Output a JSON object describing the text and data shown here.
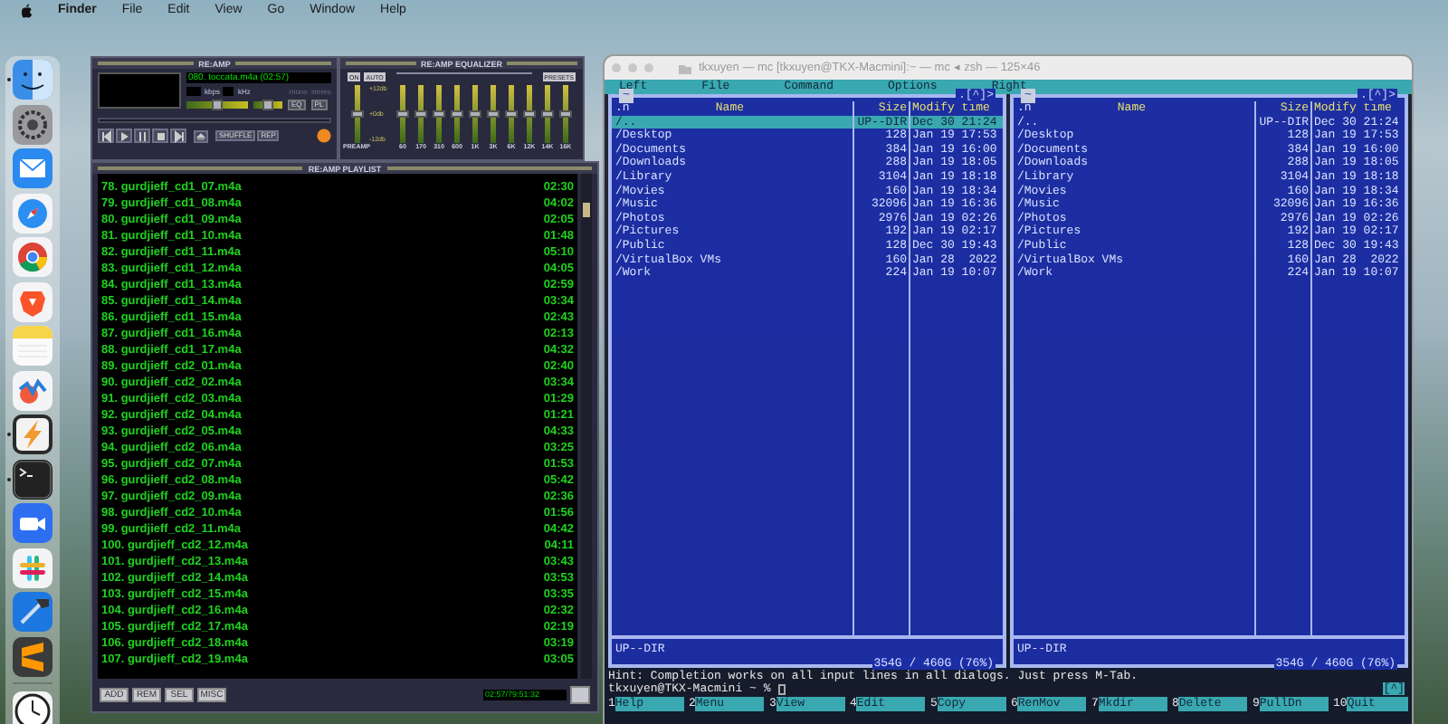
{
  "menu_bar": {
    "app": "Finder",
    "items": [
      "File",
      "Edit",
      "View",
      "Go",
      "Window",
      "Help"
    ]
  },
  "dock": {
    "items": [
      {
        "kind": "finder",
        "running": true
      },
      {
        "kind": "settings",
        "running": false
      },
      {
        "kind": "mail",
        "running": false
      },
      {
        "kind": "safari",
        "running": false
      },
      {
        "kind": "chrome",
        "running": false
      },
      {
        "kind": "brave",
        "running": false
      },
      {
        "kind": "notes",
        "running": false
      },
      {
        "kind": "freeform",
        "running": false
      },
      {
        "kind": "bolt",
        "running": true
      },
      {
        "kind": "terminal",
        "running": true
      },
      {
        "kind": "zoom",
        "running": false
      },
      {
        "kind": "slack",
        "running": false
      },
      {
        "kind": "xcode",
        "running": false
      },
      {
        "kind": "sublime",
        "running": false
      },
      {
        "kind": "clock",
        "running": false
      }
    ]
  },
  "player": {
    "title": "RE:AMP",
    "track": "080. toccata.m4a (02:57)",
    "kbps_label": "kbps",
    "khz_label": "kHz",
    "mono": "mono",
    "stereo": "stereo",
    "volume": {
      "level": 0.5
    },
    "balance": {
      "level": 0.5
    },
    "toggles": [
      "EQ",
      "PL"
    ],
    "shuffle": "SHUFFLE",
    "repeat": "REP"
  },
  "equalizer": {
    "title": "RE:AMP EQUALIZER",
    "on": "ON",
    "auto": "AUTO",
    "presets": "PRESETS",
    "scale": [
      "+12db",
      "+0db",
      "-12db"
    ],
    "bands": [
      {
        "label": "PREAMP",
        "level": 0.5
      },
      {
        "label": "60",
        "level": 0.5
      },
      {
        "label": "170",
        "level": 0.5
      },
      {
        "label": "310",
        "level": 0.5
      },
      {
        "label": "600",
        "level": 0.5
      },
      {
        "label": "1K",
        "level": 0.5
      },
      {
        "label": "3K",
        "level": 0.5
      },
      {
        "label": "6K",
        "level": 0.5
      },
      {
        "label": "12K",
        "level": 0.5
      },
      {
        "label": "14K",
        "level": 0.5
      },
      {
        "label": "16K",
        "level": 0.5
      }
    ]
  },
  "playlist": {
    "title": "RE:AMP PLAYLIST",
    "rows": [
      {
        "title": "78. gurdjieff_cd1_07.m4a",
        "time": "02:30"
      },
      {
        "title": "79. gurdjieff_cd1_08.m4a",
        "time": "04:02"
      },
      {
        "title": "80. gurdjieff_cd1_09.m4a",
        "time": "02:05"
      },
      {
        "title": "81. gurdjieff_cd1_10.m4a",
        "time": "01:48"
      },
      {
        "title": "82. gurdjieff_cd1_11.m4a",
        "time": "05:10"
      },
      {
        "title": "83. gurdjieff_cd1_12.m4a",
        "time": "04:05"
      },
      {
        "title": "84. gurdjieff_cd1_13.m4a",
        "time": "02:59"
      },
      {
        "title": "85. gurdjieff_cd1_14.m4a",
        "time": "03:34"
      },
      {
        "title": "86. gurdjieff_cd1_15.m4a",
        "time": "02:43"
      },
      {
        "title": "87. gurdjieff_cd1_16.m4a",
        "time": "02:13"
      },
      {
        "title": "88. gurdjieff_cd1_17.m4a",
        "time": "04:32"
      },
      {
        "title": "89. gurdjieff_cd2_01.m4a",
        "time": "02:40"
      },
      {
        "title": "90. gurdjieff_cd2_02.m4a",
        "time": "03:34"
      },
      {
        "title": "91. gurdjieff_cd2_03.m4a",
        "time": "01:29"
      },
      {
        "title": "92. gurdjieff_cd2_04.m4a",
        "time": "01:21"
      },
      {
        "title": "93. gurdjieff_cd2_05.m4a",
        "time": "04:33"
      },
      {
        "title": "94. gurdjieff_cd2_06.m4a",
        "time": "03:25"
      },
      {
        "title": "95. gurdjieff_cd2_07.m4a",
        "time": "01:53"
      },
      {
        "title": "96. gurdjieff_cd2_08.m4a",
        "time": "05:42"
      },
      {
        "title": "97. gurdjieff_cd2_09.m4a",
        "time": "02:36"
      },
      {
        "title": "98. gurdjieff_cd2_10.m4a",
        "time": "01:56"
      },
      {
        "title": "99. gurdjieff_cd2_11.m4a",
        "time": "04:42"
      },
      {
        "title": "100. gurdjieff_cd2_12.m4a",
        "time": "04:11"
      },
      {
        "title": "101. gurdjieff_cd2_13.m4a",
        "time": "03:43"
      },
      {
        "title": "102. gurdjieff_cd2_14.m4a",
        "time": "03:53"
      },
      {
        "title": "103. gurdjieff_cd2_15.m4a",
        "time": "03:35"
      },
      {
        "title": "104. gurdjieff_cd2_16.m4a",
        "time": "02:32"
      },
      {
        "title": "105. gurdjieff_cd2_17.m4a",
        "time": "02:19"
      },
      {
        "title": "106. gurdjieff_cd2_18.m4a",
        "time": "03:19"
      },
      {
        "title": "107. gurdjieff_cd2_19.m4a",
        "time": "03:05"
      }
    ],
    "buttons": [
      "ADD",
      "REM",
      "SEL",
      "MISC"
    ],
    "time": "02:57/79:51:32"
  },
  "terminal": {
    "title": "tkxuyen — mc [tkxuyen@TKX-Macmini]:~ — mc ◂ zsh — 125×46",
    "menu": [
      "Left",
      "File",
      "Command",
      "Options",
      "Right"
    ],
    "panels": [
      {
        "path": "~",
        "corner": ".[^]>",
        "columns": [
          ".n",
          "Name",
          "Size",
          "Modify time"
        ],
        "rows": [
          {
            "name": "/..",
            "size": "UP--DIR",
            "time": "Dec 30 21:24",
            "selected": true
          },
          {
            "name": "/Desktop",
            "size": "128",
            "time": "Jan 19 17:53",
            "selected": false
          },
          {
            "name": "/Documents",
            "size": "384",
            "time": "Jan 19 16:00",
            "selected": false
          },
          {
            "name": "/Downloads",
            "size": "288",
            "time": "Jan 19 18:05",
            "selected": false
          },
          {
            "name": "/Library",
            "size": "3104",
            "time": "Jan 19 18:18",
            "selected": false
          },
          {
            "name": "/Movies",
            "size": "160",
            "time": "Jan 19 18:34",
            "selected": false
          },
          {
            "name": "/Music",
            "size": "32096",
            "time": "Jan 19 16:36",
            "selected": false
          },
          {
            "name": "/Photos",
            "size": "2976",
            "time": "Jan 19 02:26",
            "selected": false
          },
          {
            "name": "/Pictures",
            "size": "192",
            "time": "Jan 19 02:17",
            "selected": false
          },
          {
            "name": "/Public",
            "size": "128",
            "time": "Dec 30 19:43",
            "selected": false
          },
          {
            "name": "/VirtualBox VMs",
            "size": "160",
            "time": "Jan 28  2022",
            "selected": false
          },
          {
            "name": "/Work",
            "size": "224",
            "time": "Jan 19 10:07",
            "selected": false
          }
        ],
        "status": "UP--DIR",
        "disk": "354G / 460G (76%)"
      },
      {
        "path": "~",
        "corner": ".[^]>",
        "columns": [
          ".n",
          "Name",
          "Size",
          "Modify time"
        ],
        "rows": [
          {
            "name": "/..",
            "size": "UP--DIR",
            "time": "Dec 30 21:24",
            "selected": false
          },
          {
            "name": "/Desktop",
            "size": "128",
            "time": "Jan 19 17:53",
            "selected": false
          },
          {
            "name": "/Documents",
            "size": "384",
            "time": "Jan 19 16:00",
            "selected": false
          },
          {
            "name": "/Downloads",
            "size": "288",
            "time": "Jan 19 18:05",
            "selected": false
          },
          {
            "name": "/Library",
            "size": "3104",
            "time": "Jan 19 18:18",
            "selected": false
          },
          {
            "name": "/Movies",
            "size": "160",
            "time": "Jan 19 18:34",
            "selected": false
          },
          {
            "name": "/Music",
            "size": "32096",
            "time": "Jan 19 16:36",
            "selected": false
          },
          {
            "name": "/Photos",
            "size": "2976",
            "time": "Jan 19 02:26",
            "selected": false
          },
          {
            "name": "/Pictures",
            "size": "192",
            "time": "Jan 19 02:17",
            "selected": false
          },
          {
            "name": "/Public",
            "size": "128",
            "time": "Dec 30 19:43",
            "selected": false
          },
          {
            "name": "/VirtualBox VMs",
            "size": "160",
            "time": "Jan 28  2022",
            "selected": false
          },
          {
            "name": "/Work",
            "size": "224",
            "time": "Jan 19 10:07",
            "selected": false
          }
        ],
        "status": "UP--DIR",
        "disk": "354G / 460G (76%)"
      }
    ],
    "hint": "Hint: Completion works on all input lines in all dialogs. Just press M-Tab.",
    "prompt": "tkxuyen@TKX-Macmini ~ % ",
    "prompt_corner": "[^]",
    "keys": [
      {
        "number": "1",
        "label": "Help"
      },
      {
        "number": "2",
        "label": "Menu"
      },
      {
        "number": "3",
        "label": "View"
      },
      {
        "number": "4",
        "label": "Edit"
      },
      {
        "number": "5",
        "label": "Copy"
      },
      {
        "number": "6",
        "label": "RenMov"
      },
      {
        "number": "7",
        "label": "Mkdir"
      },
      {
        "number": "8",
        "label": "Delete"
      },
      {
        "number": "9",
        "label": "PullDn"
      },
      {
        "number": "10",
        "label": "Quit"
      }
    ]
  }
}
